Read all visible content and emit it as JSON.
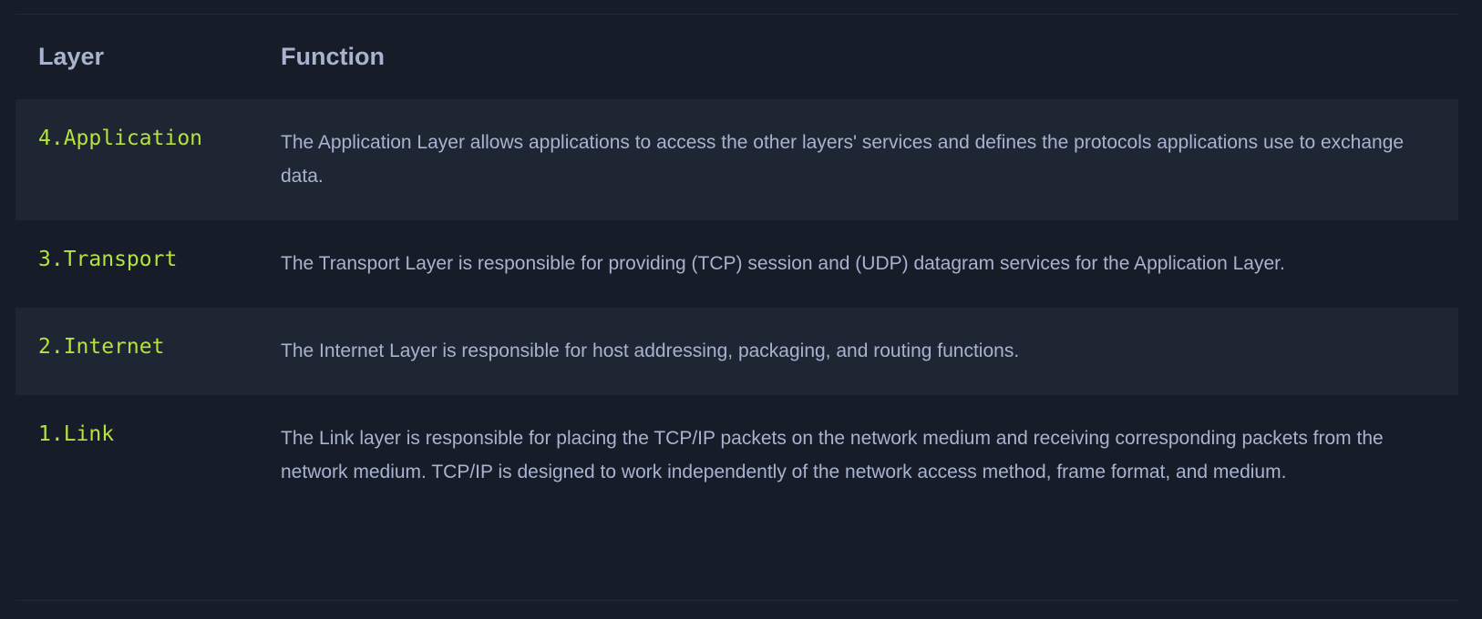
{
  "table": {
    "headers": {
      "layer": "Layer",
      "function": "Function"
    },
    "rows": [
      {
        "layer": "4.Application",
        "function": "The Application Layer allows applications to access the other layers' services and defines the protocols applications use to exchange data."
      },
      {
        "layer": "3.Transport",
        "function": "The Transport Layer is responsible for providing (TCP) session and (UDP) datagram services for the Application Layer."
      },
      {
        "layer": "2.Internet",
        "function": "The Internet Layer is responsible for host addressing, packaging, and routing functions."
      },
      {
        "layer": "1.Link",
        "function": "The Link layer is responsible for placing the TCP/IP packets on the network medium and receiving corresponding packets from the network medium. TCP/IP is designed to work independently of the network access method, frame format, and medium."
      }
    ]
  },
  "colors": {
    "background": "#161c28",
    "row_alt": "#1e2533",
    "text": "#a8b3cf",
    "accent": "#b5e33d"
  }
}
